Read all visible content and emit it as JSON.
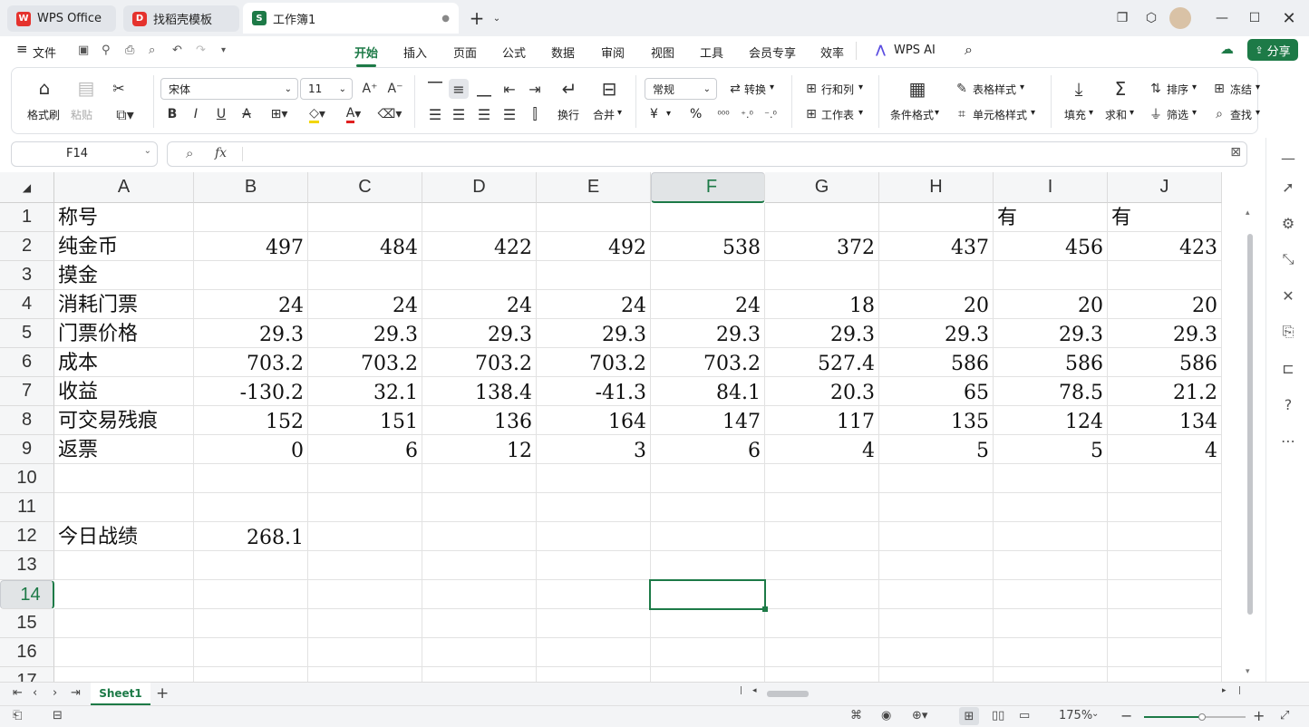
{
  "tabs": [
    {
      "label": "WPS Office",
      "icon": "wps-logo-icon",
      "color": "#e5322d"
    },
    {
      "label": "找稻壳模板",
      "icon": "docer-icon",
      "color": "#e5322d"
    },
    {
      "label": "工作簿1",
      "icon": "spreadsheet-s-icon",
      "color": "#1d7a47"
    }
  ],
  "menu": {
    "file": "文件",
    "items": [
      "开始",
      "插入",
      "页面",
      "公式",
      "数据",
      "审阅",
      "视图",
      "工具",
      "会员专享",
      "效率"
    ],
    "active": "开始",
    "wps_ai": "WPS AI",
    "share": "分享"
  },
  "ribbon": {
    "format_painter": "格式刷",
    "paste": "粘贴",
    "font_name": "宋体",
    "font_size": "11",
    "wrap": "换行",
    "merge": "合并",
    "number_format": "常规",
    "convert": "转换",
    "row_col": "行和列",
    "worksheet": "工作表",
    "cond_format": "条件格式",
    "table_style": "表格样式",
    "cell_style": "单元格样式",
    "fill": "填充",
    "sum": "求和",
    "sort": "排序",
    "filter": "筛选",
    "freeze": "冻结",
    "find": "查找",
    "currency_symbol": "¥",
    "percent_symbol": "%"
  },
  "formula_bar": {
    "cell_ref": "F14",
    "fx": "fx",
    "value": ""
  },
  "grid": {
    "columns": [
      "A",
      "B",
      "C",
      "D",
      "E",
      "F",
      "G",
      "H",
      "I",
      "J"
    ],
    "selected_col": "F",
    "selected_row": "14",
    "row_numbers": [
      "1",
      "2",
      "3",
      "4",
      "5",
      "6",
      "7",
      "8",
      "9",
      "10",
      "11",
      "12",
      "13",
      "14",
      "15",
      "16",
      "17"
    ],
    "rows": [
      [
        "称号",
        "",
        "",
        "",
        "",
        "",
        "",
        "",
        "有",
        "有"
      ],
      [
        "纯金币",
        "497",
        "484",
        "422",
        "492",
        "538",
        "372",
        "437",
        "456",
        "423"
      ],
      [
        "摸金",
        "",
        "",
        "",
        "",
        "",
        "",
        "",
        "",
        ""
      ],
      [
        "消耗门票",
        "24",
        "24",
        "24",
        "24",
        "24",
        "18",
        "20",
        "20",
        "20"
      ],
      [
        "门票价格",
        "29.3",
        "29.3",
        "29.3",
        "29.3",
        "29.3",
        "29.3",
        "29.3",
        "29.3",
        "29.3"
      ],
      [
        "成本",
        "703.2",
        "703.2",
        "703.2",
        "703.2",
        "703.2",
        "527.4",
        "586",
        "586",
        "586"
      ],
      [
        "收益",
        "-130.2",
        "32.1",
        "138.4",
        "-41.3",
        "84.1",
        "20.3",
        "65",
        "78.5",
        "21.2"
      ],
      [
        "可交易残痕",
        "152",
        "151",
        "136",
        "164",
        "147",
        "117",
        "135",
        "124",
        "134"
      ],
      [
        "返票",
        "0",
        "6",
        "12",
        "3",
        "6",
        "4",
        "5",
        "5",
        "4"
      ],
      [
        "",
        "",
        "",
        "",
        "",
        "",
        "",
        "",
        "",
        ""
      ],
      [
        "",
        "",
        "",
        "",
        "",
        "",
        "",
        "",
        "",
        ""
      ],
      [
        "今日战绩",
        "268.1",
        "",
        "",
        "",
        "",
        "",
        "",
        "",
        ""
      ],
      [
        "",
        "",
        "",
        "",
        "",
        "",
        "",
        "",
        "",
        ""
      ],
      [
        "",
        "",
        "",
        "",
        "",
        "",
        "",
        "",
        "",
        ""
      ],
      [
        "",
        "",
        "",
        "",
        "",
        "",
        "",
        "",
        "",
        ""
      ],
      [
        "",
        "",
        "",
        "",
        "",
        "",
        "",
        "",
        "",
        ""
      ],
      [
        "",
        "",
        "",
        "",
        "",
        "",
        "",
        "",
        "",
        ""
      ]
    ]
  },
  "sheet_tabs": {
    "active": "Sheet1"
  },
  "status": {
    "zoom": "175%"
  }
}
